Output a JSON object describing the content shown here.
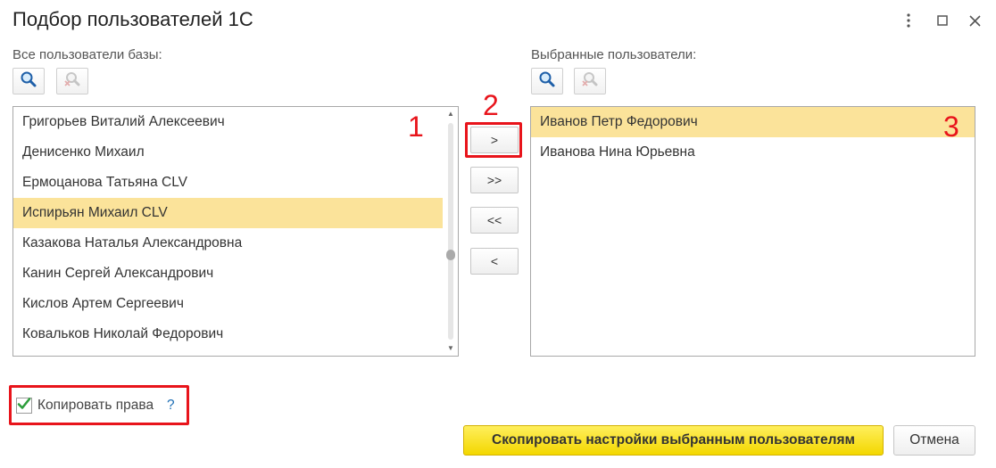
{
  "window": {
    "title": "Подбор пользователей 1С",
    "menu_icon": "more-vertical-icon",
    "maximize_icon": "maximize-icon",
    "close_icon": "close-icon"
  },
  "left_panel": {
    "label": "Все пользователи базы:",
    "users": [
      "Григорьев Виталий Алексеевич",
      "Денисенко Михаил",
      "Ермоцанова Татьяна CLV",
      "Испирьян Михаил CLV",
      "Казакова Наталья Александровна",
      "Канин Сергей Александрович",
      "Кислов Артем Сергеевич",
      "Ковальков Николай Федорович"
    ],
    "selected_index": 3
  },
  "move_buttons": {
    "add": ">",
    "add_all": ">>",
    "remove_all": "<<",
    "remove": "<"
  },
  "right_panel": {
    "label": "Выбранные пользователи:",
    "users": [
      "Иванов Петр Федорович",
      "Иванова Нина Юрьевна"
    ],
    "selected_index": 0
  },
  "annotations": {
    "one": "1",
    "two": "2",
    "three": "3"
  },
  "options": {
    "copy_rights_label": "Копировать права",
    "copy_rights_checked": true,
    "help": "?"
  },
  "footer": {
    "primary_label": "Скопировать настройки выбранным пользователям",
    "cancel_label": "Отмена"
  },
  "colors": {
    "selection": "#fbe39a",
    "annotation_red": "#e8141b",
    "primary_button": "#f3d700",
    "check_green": "#2e9e3c"
  }
}
